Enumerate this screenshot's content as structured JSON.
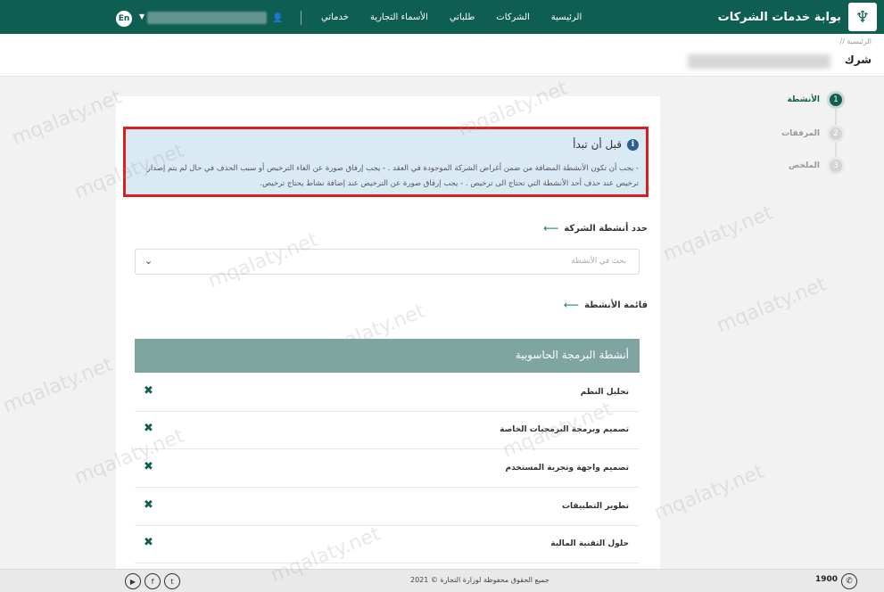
{
  "topbar": {
    "brand_title": "بوابة خدمات الشركات",
    "nav": [
      "الرئيسية",
      "الشركات",
      "طلباتي",
      "الأسماء التجارية",
      "خدماتي"
    ],
    "language": "En"
  },
  "header": {
    "breadcrumb": "الرئيسية //",
    "page_title": "شرك"
  },
  "stepper": [
    {
      "number": "1",
      "label": "الأنشطة",
      "active": true
    },
    {
      "number": "2",
      "label": "المرفقات",
      "active": false
    },
    {
      "number": "3",
      "label": "الملخص",
      "active": false
    }
  ],
  "notice": {
    "heading": "قبل أن تبدأ",
    "text": "- يجب أن تكون الأنشطة المضافة من ضمن أغراض الشركة الموجودة في العقد . - يجب إرفاق صورة عن الغاء الترخيص أو سبب الحذف في حال لم يتم إصدار ترخيص عند حذف أحد الأنشطة التي تحتاج الى ترخيص . - يجب إرفاق صورة عن الترخيص عند إضافة نشاط يحتاج ترخيص."
  },
  "select_section": {
    "label": "حدد أنشطة الشركة",
    "placeholder": "بحث في الأنشطة"
  },
  "list_section": {
    "label": "قائمة الأنشطة",
    "group_title": "أنشطة البرمجة الحاسوبية",
    "activities": [
      "تحليل النظم",
      "تصميم وبرمجة البرمجيات الخاصة",
      "تصميم واجهة وتجربة المستخدم",
      "تطوير التطبيقات",
      "حلول التقنية المالية"
    ]
  },
  "footer": {
    "copyright": "جميع الحقوق محفوظة لوزارة التجارة © 2021",
    "phone": "1900"
  },
  "watermark": "mqalaty.net",
  "colors": {
    "primary": "#0f5e52",
    "group_header": "#7ea5a0",
    "notice_bg": "#d9eaf5",
    "notice_border": "#d92020"
  }
}
